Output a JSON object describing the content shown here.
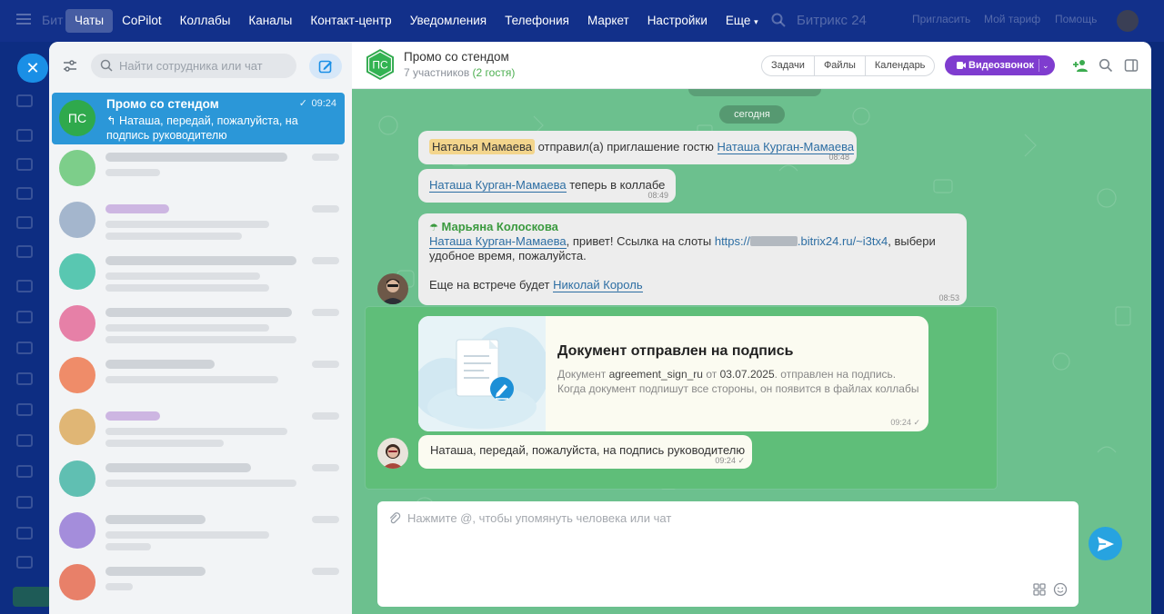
{
  "menu": {
    "items": [
      "Чаты",
      "CoPilot",
      "Коллабы",
      "Каналы",
      "Контакт-центр",
      "Уведомления",
      "Телефония",
      "Маркет",
      "Настройки",
      "Еще"
    ],
    "active": "Чаты"
  },
  "topbar_dim": {
    "left_label": "Бит",
    "brand": "Битрикс 24",
    "invite": "Пригласить",
    "tariff": "Мой тариф",
    "help": "Помощь"
  },
  "sidebar": {
    "search_placeholder": "Найти сотрудника или чат",
    "active_chat": {
      "title": "Промо со стендом",
      "time": "09:24",
      "check": "✓",
      "last_message": "↰ Наташа, передай, пожалуйста, на подпись руководителю",
      "avatar_text": "ПС"
    }
  },
  "chat": {
    "title": "Промо со стендом",
    "participants": "7 участников",
    "guests": "(2 гостя)",
    "tabs": [
      "Задачи",
      "Файлы",
      "Календарь"
    ],
    "video_button": "Видеозвонок",
    "date_divider": "сегодня",
    "messages": {
      "m1": {
        "author_chip": "Наталья Мамаева",
        "text": "отправил(а) приглашение гостю",
        "link": "Наташа Курган-Мамаева",
        "time": "08:48"
      },
      "m2": {
        "link": "Наташа Курган-Мамаева",
        "text": "теперь в коллабе",
        "time": "08:49"
      },
      "m3": {
        "author": "Марьяна Колоскова",
        "link": "Наташа Курган-Мамаева",
        "text_a": ", привет! Ссылка на слоты",
        "url_a": "https://",
        "url_b": ".bitrix24.ru/~i3tx4",
        "text_b": ", выбери",
        "text_c": "удобное время, пожалуйста.",
        "text_d": "Еще на встрече будет",
        "link2": "Николай Король",
        "time": "08:53"
      },
      "card": {
        "title": "Документ отправлен на подпись",
        "desc_a": "Документ",
        "doc_name": "agreement_sign_ru",
        "desc_b": "от",
        "doc_date": "03.07.2025",
        "desc_c": ". отправлен на подпись. Когда документ подпишут все стороны, он появится в файлах коллабы",
        "time": "09:24 ✓"
      },
      "m4": {
        "text": "Наташа, передай, пожалуйста, на подпись руководителю",
        "time": "09:24 ✓"
      }
    },
    "composer_placeholder": "Нажмите @, чтобы упомянуть человека или чат"
  },
  "colors": {
    "accent": "#2b97d8",
    "video": "#7f3ccf",
    "chat_bg": "#6cc08e",
    "highlight": "#5fbe79",
    "author_green": "#3b9a3f",
    "send": "#27a3e0"
  }
}
